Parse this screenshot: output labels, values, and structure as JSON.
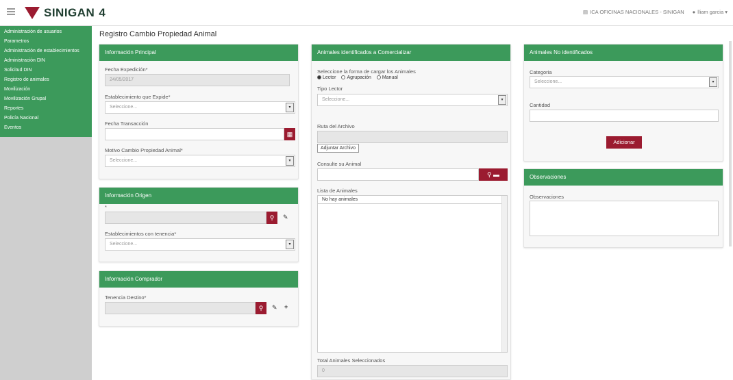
{
  "header": {
    "app_name": "SINIGAN",
    "version": "4",
    "office": "ICA OFICINAS NACIONALES - SINIGAN",
    "user": "lliam garcia"
  },
  "sidebar": {
    "items": [
      {
        "label": "Administración de usuarios"
      },
      {
        "label": "Parametros"
      },
      {
        "label": "Administración de establecimientos"
      },
      {
        "label": "Administración DIN"
      },
      {
        "label": "Solicitud DIN"
      },
      {
        "label": "Registro de animales"
      },
      {
        "label": "Movilización"
      },
      {
        "label": "Movilización Grupal"
      },
      {
        "label": "Reportes"
      },
      {
        "label": "Policía Nacional"
      },
      {
        "label": "Eventos"
      }
    ]
  },
  "page": {
    "title": "Registro Cambio Propiedad Animal"
  },
  "info_principal": {
    "title": "Información Principal",
    "fecha_expedicion_label": "Fecha Expedición",
    "fecha_expedicion_value": "24/05/2017",
    "establecimiento_label": "Establecimiento que Expide",
    "establecimiento_placeholder": "Seleccione...",
    "fecha_transaccion_label": "Fecha Transacción",
    "motivo_label": "Motivo Cambio Propiedad Animal",
    "motivo_placeholder": "Seleccione..."
  },
  "info_origen": {
    "title": "Información Origen",
    "establecimientos_label": "Establecimientos con tenencia",
    "establecimientos_placeholder": "Seleccione..."
  },
  "info_comprador": {
    "title": "Información Comprador",
    "tenencia_label": "Tenencia Destino"
  },
  "animales_id": {
    "title": "Animales identificados a Comercializar",
    "forma_label": "Seleccione la forma de cargar los Animales",
    "radio_options": [
      "Lector",
      "Agrupación",
      "Manual"
    ],
    "tipo_lector_label": "Tipo Lector",
    "tipo_lector_placeholder": "Seleccione...",
    "ruta_label": "Ruta del Archivo",
    "adjuntar_label": "Adjuntar Archivo",
    "consulta_label": "Consulte su Animal",
    "lista_label": "Lista de Animales",
    "lista_empty": "No hay animales",
    "total_label": "Total Animales Seleccionados",
    "total_value": "0"
  },
  "animales_no_id": {
    "title": "Animales No identificados",
    "categoria_label": "Categoria",
    "categoria_placeholder": "Seleccione...",
    "cantidad_label": "Cantidad",
    "adicionar_label": "Adicionar"
  },
  "observaciones": {
    "title": "Observaciones",
    "label": "Observaciones"
  },
  "icons": {
    "menu": "menu-icon",
    "calendar": "calendar-icon",
    "search": "search-icon",
    "edit": "pencil-icon",
    "add": "plus-icon",
    "folder": "folder-icon",
    "office": "building-icon",
    "user": "user-icon"
  },
  "colors": {
    "green": "#3c9a5b",
    "red": "#9b1b30"
  }
}
